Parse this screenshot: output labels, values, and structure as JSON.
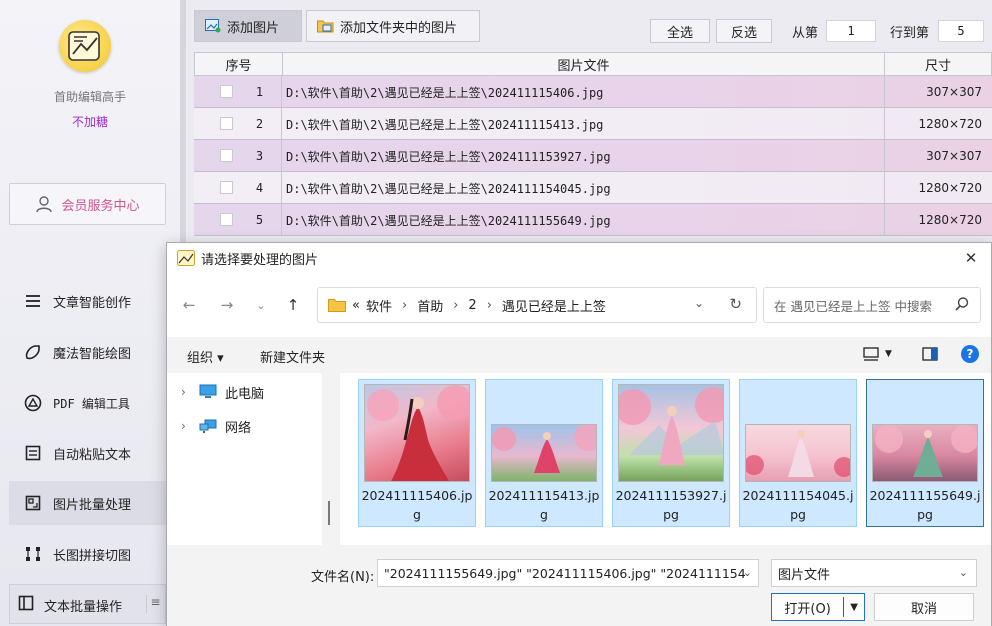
{
  "sidebar": {
    "app_name": "首助编辑高手",
    "app_sub": "不加糖",
    "member_center": "会员服务中心",
    "items": [
      {
        "label": "文章智能创作",
        "icon": "menu-lines-icon"
      },
      {
        "label": "魔法智能绘图",
        "icon": "magic-wand-icon"
      },
      {
        "label": "PDF 编辑工具",
        "icon": "pdf-tool-icon"
      },
      {
        "label": "自动粘贴文本",
        "icon": "paste-text-icon"
      },
      {
        "label": "图片批量处理",
        "icon": "image-batch-icon",
        "active": true
      },
      {
        "label": "长图拼接切图",
        "icon": "long-image-icon"
      },
      {
        "label": "文本批量操作",
        "icon": "text-batch-icon"
      }
    ]
  },
  "toolbar": {
    "add_image": "添加图片",
    "add_folder": "添加文件夹中的图片",
    "select_all": "全选",
    "invert": "反选",
    "from_label": "从第",
    "from_value": "1",
    "to_label": "行到第",
    "to_value": "5"
  },
  "table": {
    "headers": [
      "序号",
      "图片文件",
      "尺寸"
    ],
    "rows": [
      {
        "index": "1",
        "path": "D:\\软件\\首助\\2\\遇见已经是上上签\\202411115406.jpg",
        "size": "307×307"
      },
      {
        "index": "2",
        "path": "D:\\软件\\首助\\2\\遇见已经是上上签\\202411115413.jpg",
        "size": "1280×720"
      },
      {
        "index": "3",
        "path": "D:\\软件\\首助\\2\\遇见已经是上上签\\2024111153927.jpg",
        "size": "307×307"
      },
      {
        "index": "4",
        "path": "D:\\软件\\首助\\2\\遇见已经是上上签\\2024111154045.jpg",
        "size": "1280×720"
      },
      {
        "index": "5",
        "path": "D:\\软件\\首助\\2\\遇见已经是上上签\\2024111155649.jpg",
        "size": "1280×720"
      }
    ]
  },
  "dialog": {
    "title": "请选择要处理的图片",
    "breadcrumb": [
      "«",
      "软件",
      "首助",
      "2",
      "遇见已经是上上签"
    ],
    "search_placeholder": "在 遇见已经是上上签 中搜索",
    "organize": "组织 ▾",
    "new_folder": "新建文件夹",
    "tree": [
      "此电脑",
      "网络"
    ],
    "files": [
      {
        "name": "202411115406.jpg"
      },
      {
        "name": "202411115413.jpg"
      },
      {
        "name": "2024111153927.jpg"
      },
      {
        "name": "2024111154045.jpg"
      },
      {
        "name": "2024111155649.jpg"
      }
    ],
    "filename_label": "文件名(N):",
    "filename_value": "\"2024111155649.jpg\" \"202411115406.jpg\" \"2024111154",
    "file_type": "图片文件",
    "open": "打开(O)",
    "cancel": "取消"
  },
  "colors": {
    "accent": "#9b2fc8",
    "member": "#d0558b",
    "row_odd": "#e6d4ea",
    "selection": "#cde8ff",
    "selection_border": "#99d1ff",
    "help_blue": "#1a73e8"
  }
}
